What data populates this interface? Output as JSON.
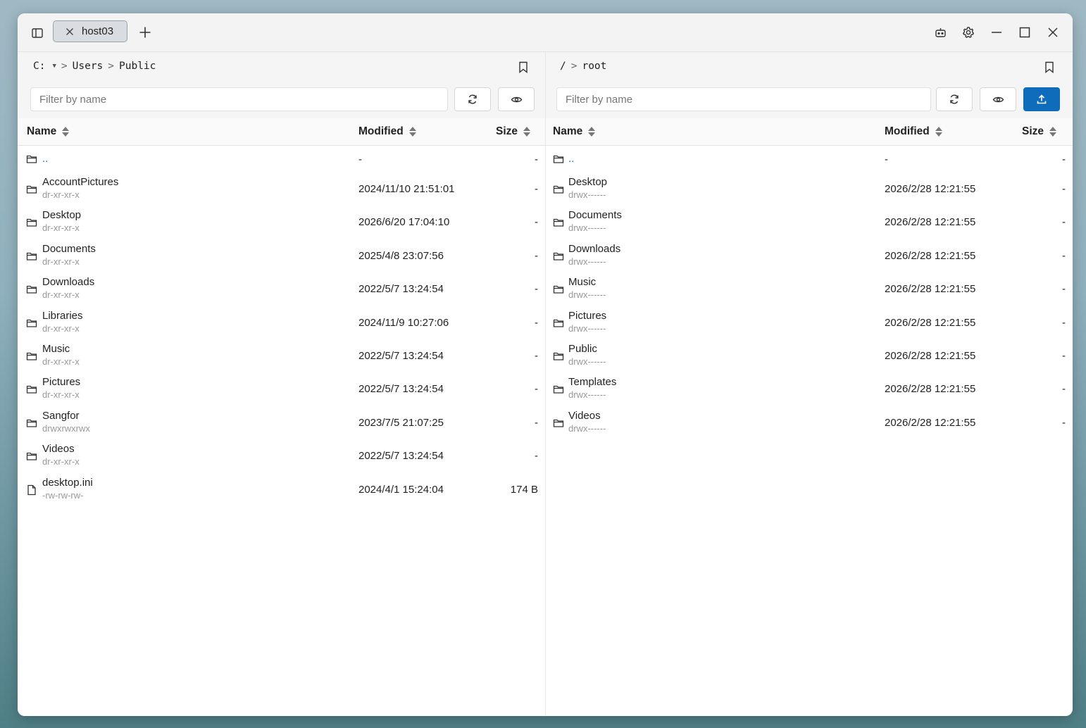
{
  "tab": {
    "label": "host03"
  },
  "left": {
    "crumbs": {
      "drive": "C:",
      "sep": ">",
      "dir1": "Users",
      "dir2": "Public"
    },
    "filter_placeholder": "Filter by name",
    "headers": {
      "name": "Name",
      "modified": "Modified",
      "size": "Size"
    },
    "up": {
      "name": "..",
      "modified": "-",
      "size": "-"
    },
    "rows": [
      {
        "name": "AccountPictures",
        "perm": "dr-xr-xr-x",
        "modified": "2024/11/10 21:51:01",
        "size": "-"
      },
      {
        "name": "Desktop",
        "perm": "dr-xr-xr-x",
        "modified": "2026/6/20 17:04:10",
        "size": "-"
      },
      {
        "name": "Documents",
        "perm": "dr-xr-xr-x",
        "modified": "2025/4/8 23:07:56",
        "size": "-"
      },
      {
        "name": "Downloads",
        "perm": "dr-xr-xr-x",
        "modified": "2022/5/7 13:24:54",
        "size": "-"
      },
      {
        "name": "Libraries",
        "perm": "dr-xr-xr-x",
        "modified": "2024/11/9 10:27:06",
        "size": "-"
      },
      {
        "name": "Music",
        "perm": "dr-xr-xr-x",
        "modified": "2022/5/7 13:24:54",
        "size": "-"
      },
      {
        "name": "Pictures",
        "perm": "dr-xr-xr-x",
        "modified": "2022/5/7 13:24:54",
        "size": "-"
      },
      {
        "name": "Sangfor",
        "perm": "drwxrwxrwx",
        "modified": "2023/7/5 21:07:25",
        "size": "-"
      },
      {
        "name": "Videos",
        "perm": "dr-xr-xr-x",
        "modified": "2022/5/7 13:24:54",
        "size": "-"
      },
      {
        "name": "desktop.ini",
        "perm": "-rw-rw-rw-",
        "modified": "2024/4/1 15:24:04",
        "size": "174 B"
      }
    ]
  },
  "right": {
    "crumbs": {
      "root": "/",
      "sep": ">",
      "dir1": "root"
    },
    "filter_placeholder": "Filter by name",
    "headers": {
      "name": "Name",
      "modified": "Modified",
      "size": "Size"
    },
    "up": {
      "name": "..",
      "modified": "-",
      "size": "-"
    },
    "rows": [
      {
        "name": "Desktop",
        "perm": "drwx------",
        "modified": "2026/2/28 12:21:55",
        "size": "-"
      },
      {
        "name": "Documents",
        "perm": "drwx------",
        "modified": "2026/2/28 12:21:55",
        "size": "-"
      },
      {
        "name": "Downloads",
        "perm": "drwx------",
        "modified": "2026/2/28 12:21:55",
        "size": "-"
      },
      {
        "name": "Music",
        "perm": "drwx------",
        "modified": "2026/2/28 12:21:55",
        "size": "-"
      },
      {
        "name": "Pictures",
        "perm": "drwx------",
        "modified": "2026/2/28 12:21:55",
        "size": "-"
      },
      {
        "name": "Public",
        "perm": "drwx------",
        "modified": "2026/2/28 12:21:55",
        "size": "-"
      },
      {
        "name": "Templates",
        "perm": "drwx------",
        "modified": "2026/2/28 12:21:55",
        "size": "-"
      },
      {
        "name": "Videos",
        "perm": "drwx------",
        "modified": "2026/2/28 12:21:55",
        "size": "-"
      }
    ]
  },
  "icons": {
    "sidebar": "sidebar-toggle-icon",
    "tab_close": "close-icon",
    "new_tab": "plus-icon",
    "robot": "robot-icon",
    "settings": "gear-icon",
    "minimize": "minimize-icon",
    "maximize": "maximize-icon",
    "close": "close-icon",
    "bookmark": "bookmark-icon",
    "refresh": "refresh-icon",
    "visibility": "eye-icon",
    "upload": "upload-icon",
    "folder": "folder-icon",
    "file": "file-icon"
  },
  "colors": {
    "accent": "#0f6cbd",
    "link": "#0f6cbd",
    "muted": "#999999"
  }
}
